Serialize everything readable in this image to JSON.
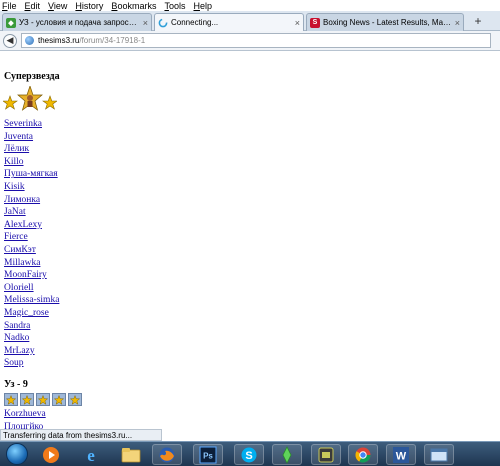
{
  "menu": [
    "File",
    "Edit",
    "View",
    "History",
    "Bookmarks",
    "Tools",
    "Help"
  ],
  "tabs": [
    {
      "title": "УЗ - условия и подача запросов - Т...",
      "favicon": "sims-icon",
      "color": "#3a9a3a"
    },
    {
      "title": "Connecting...",
      "favicon": "loading-icon",
      "color": "#2f9fd8"
    },
    {
      "title": "Boxing News - Latest Results, Matche...",
      "favicon": "s-logo-icon",
      "color": "#c8102e"
    }
  ],
  "tab_close": "×",
  "new_tab": "+",
  "address": {
    "host": "thesims3.ru",
    "path": "/forum/34-17918-1"
  },
  "page": {
    "section1_title": "Суперзвезда",
    "users": [
      "Severinka",
      "Juventa",
      "Лёлик",
      "Killo",
      "Пуша-мягкая",
      "Kisik",
      "Лимонка",
      "JaNat",
      "AlexLexy",
      "Fierce",
      "СимКэт",
      "Millawka",
      "MoonFairy",
      "Oloriell",
      "Melissa-simka",
      "Magic_rose",
      "Sandra",
      "Nadko",
      "MrLazy",
      "Soup"
    ],
    "section2_title": "Уз - 9",
    "section2_star_count": 5,
    "users2": [
      "Korzhueva",
      "Плоцгйко"
    ]
  },
  "status": "Transferring data from thesims3.ru...",
  "taskbar": [
    "start",
    "media-player-icon",
    "ie-icon",
    "explorer-icon",
    "firefox-icon",
    "photoshop-icon",
    "skype-icon",
    "sims-icon",
    "game-icon",
    "chrome-icon",
    "word-icon",
    "window-icon"
  ],
  "colors": {
    "link": "#1a0dab",
    "star_gold": "#f0b800"
  }
}
